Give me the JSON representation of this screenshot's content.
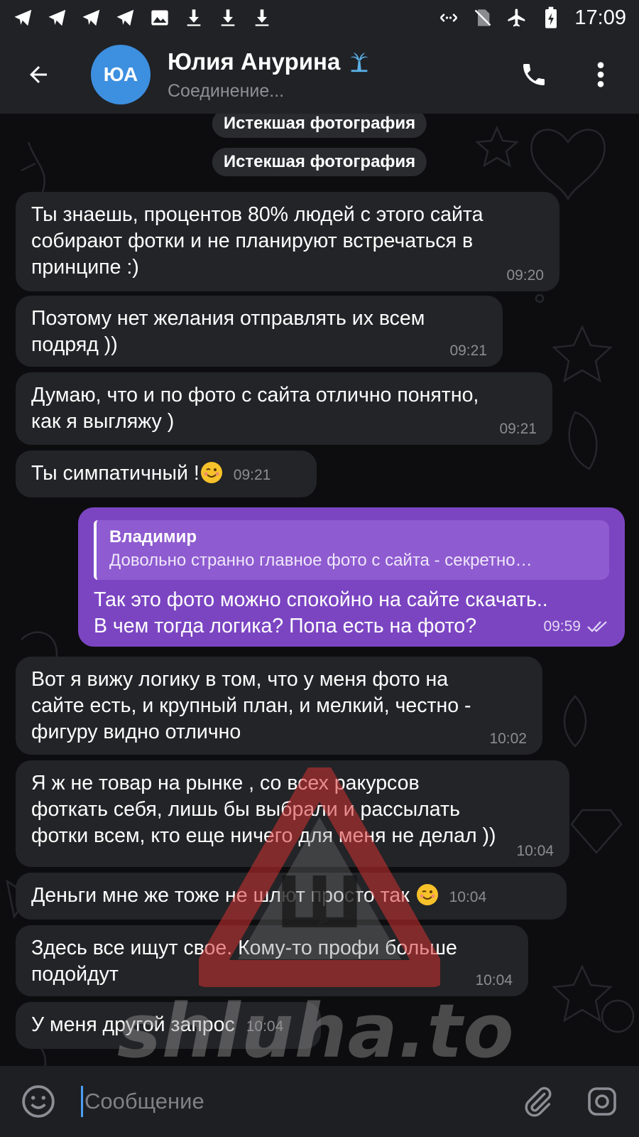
{
  "status_bar": {
    "time": "17:09",
    "left_icons": [
      "telegram-icon",
      "telegram-icon",
      "telegram-icon",
      "telegram-icon",
      "image-icon",
      "download-icon",
      "download-icon",
      "download-icon"
    ],
    "right_icons": [
      "data-icon",
      "no-sim-icon",
      "airplane-icon",
      "battery-icon"
    ]
  },
  "header": {
    "avatar_initials": "ЮА",
    "contact_name": "Юлия Анурина",
    "status": "Соединение...",
    "avatar_color": "#3d8fe0"
  },
  "service_messages": [
    {
      "label": "Истекшая фотография"
    },
    {
      "label": "Истекшая фотография"
    }
  ],
  "messages_before": [
    {
      "text": "Ты знаешь, процентов 80% людей с этого сайта\nсобирают фотки и не планируют встречаться в\nпринципе :)",
      "time": "09:20"
    },
    {
      "text": "Поэтому нет желания отправлять их всем\nподряд ))",
      "time": "09:21"
    },
    {
      "text": "Думаю, что и по фото с сайта отлично понятно,\nкак я выгляжу )",
      "time": "09:21"
    },
    {
      "text": "Ты симпатичный !",
      "time": "09:21",
      "emoji": "wink"
    }
  ],
  "outgoing": {
    "reply_name": "Владимир",
    "reply_text": "Довольно странно главное фото с сайта - секретно…",
    "text": "Так это фото можно спокойно на сайте скачать..\nВ чем тогда логика? Попа есть на фото?",
    "time": "09:59",
    "read": true,
    "bubble_color": "#7b45c2"
  },
  "messages_after": [
    {
      "text": "Вот я вижу логику в том, что у меня фото на\nсайте есть, и крупный план, и мелкий, честно -\nфигуру видно отлично",
      "time": "10:02"
    },
    {
      "text": "Я ж не товар на рынке , со всех ракурсов\nфоткать себя, лишь бы выбрали и рассылать\nфотки всем, кто еще ничего для меня не делал ))",
      "time": "10:04"
    },
    {
      "text": "Деньги мне же тоже не шлют просто так ",
      "time": "10:04",
      "emoji": "wink"
    },
    {
      "text": "Здесь все ищут свое. Кому-то профи больше\nподойдут",
      "time": "10:04"
    },
    {
      "text": "У меня другой запрос",
      "time": "10:04"
    }
  ],
  "watermark": {
    "text": "shluha.to",
    "sign_letter": "Ш"
  },
  "input": {
    "placeholder": "Сообщение"
  }
}
